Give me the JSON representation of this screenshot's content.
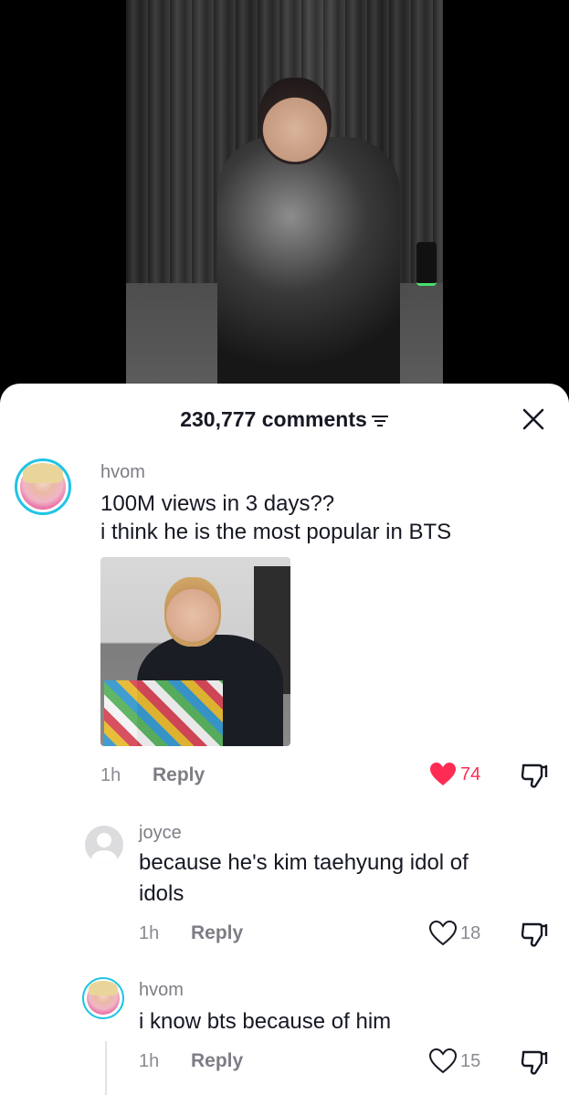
{
  "sheet": {
    "comment_count": "230,777 comments"
  },
  "comments": [
    {
      "username": "hvom",
      "lines": [
        "100M views in 3 days??",
        "i think he is the most popular in BTS"
      ],
      "time": "1h",
      "reply_label": "Reply",
      "likes": "74",
      "liked": true
    },
    {
      "username": "joyce",
      "lines": [
        "because he's kim taehyung idol of",
        "idols"
      ],
      "time": "1h",
      "reply_label": "Reply",
      "likes": "18",
      "liked": false
    },
    {
      "username": "hvom",
      "lines": [
        "i know bts because of him"
      ],
      "time": "1h",
      "reply_label": "Reply",
      "likes": "15",
      "liked": false
    }
  ],
  "colors": {
    "like_active": "#fe2c55",
    "avatar_ring": "#20c4e4",
    "text_primary": "#161823",
    "text_secondary": "#8a8b91"
  },
  "icons": {
    "sort": "sort-icon",
    "close": "close-icon",
    "like": "heart-icon",
    "dislike": "thumbs-down-icon"
  }
}
